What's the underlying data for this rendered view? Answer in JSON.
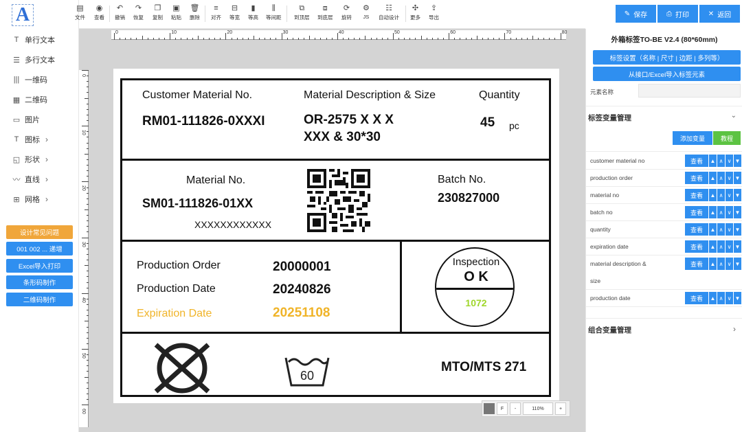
{
  "sidebar": {
    "logo": "A",
    "tools": [
      {
        "icon": "T",
        "label": "单行文本"
      },
      {
        "icon": "☰",
        "label": "多行文本"
      },
      {
        "icon": "|||",
        "label": "一维码"
      },
      {
        "icon": "▦",
        "label": "二维码"
      },
      {
        "icon": "▭",
        "label": "图片"
      },
      {
        "icon": "T",
        "label": "图标",
        "chevron": "›"
      },
      {
        "icon": "◱",
        "label": "形状",
        "chevron": "›"
      },
      {
        "icon": "〰",
        "label": "直线",
        "chevron": "›"
      },
      {
        "icon": "⊞",
        "label": "网格",
        "chevron": "›"
      }
    ],
    "buttons": [
      "设计常见问题",
      "001 002 ... 递增",
      "Excel导入打印",
      "条形码制作",
      "二维码制作"
    ]
  },
  "toolbar": {
    "items": [
      {
        "icon": "▤",
        "label": "文件"
      },
      {
        "icon": "◉",
        "label": "查看"
      },
      {
        "icon": "↶",
        "label": "撤销"
      },
      {
        "icon": "↷",
        "label": "恢复"
      },
      {
        "icon": "❐",
        "label": "复制"
      },
      {
        "icon": "▣",
        "label": "粘贴"
      },
      {
        "icon": "🗑",
        "label": "删除"
      },
      {
        "icon": "≡",
        "label": "对齐"
      },
      {
        "icon": "⊟",
        "label": "等宽"
      },
      {
        "icon": "▮",
        "label": "等高"
      },
      {
        "icon": "⫼",
        "label": "等间距"
      },
      {
        "icon": "⧉",
        "label": "到顶层"
      },
      {
        "icon": "⧈",
        "label": "到底层"
      },
      {
        "icon": "⟳",
        "label": "旋转"
      },
      {
        "icon": "⚙",
        "label": "JS"
      },
      {
        "icon": "☷",
        "label": "自动设计"
      },
      {
        "icon": "✣",
        "label": "更多"
      },
      {
        "icon": "⇪",
        "label": "导出"
      }
    ],
    "save": "保存",
    "print": "打印",
    "back": "返回"
  },
  "ruler": {
    "top": [
      "0",
      "10",
      "20",
      "30",
      "40",
      "50",
      "60",
      "70",
      "80"
    ],
    "left": [
      "0",
      "10",
      "20",
      "30",
      "40",
      "50",
      "60"
    ]
  },
  "label": {
    "customer_material_title": "Customer Material No.",
    "customer_material_value": "RM01-111826-0XXXI",
    "desc_title": "Material Description & Size",
    "desc_line1": "OR-2575 X X X",
    "desc_line2": "XXX &  30*30",
    "qty_title": "Quantity",
    "qty_value": "45",
    "qty_unit": "pc",
    "material_title": "Material No.",
    "material_value": "SM01-111826-01XX",
    "material_sub": "XXXXXXXXXXXX",
    "batch_title": "Batch No.",
    "batch_value": "230827000",
    "prod_order_label": "Production Order",
    "prod_order_value": "20000001",
    "prod_date_label": "Production Date",
    "prod_date_value": "20240826",
    "exp_date_label": "Expiration Date",
    "exp_date_value": "20251108",
    "inspection_title": "Inspection",
    "inspection_ok": "O K",
    "inspection_code": "1072",
    "wash_temp": "60",
    "mto": "MTO/MTS 271"
  },
  "zoom": {
    "f": "F",
    "minus": "-",
    "value": "110%",
    "plus": "+"
  },
  "right": {
    "title": "外箱标签TO-BE V2.4 (80*60mm)",
    "settings_btn": "标签设置（名称 | 尺寸 | 边距 | 多列等）",
    "import_btn": "从接口/Excel导入标签元素",
    "element_name_label": "元素名称",
    "var_section": "标签变量管理",
    "add_var": "添加变量",
    "tutorial": "教程",
    "view": "查看",
    "variables": [
      "customer material no",
      "production order",
      "material no",
      "batch no",
      "quantity",
      "expiration date",
      "material description &",
      "production date"
    ],
    "size_label": "size",
    "combo_section": "组合变量管理"
  },
  "colors": {
    "primary": "#2f8ff0",
    "orange": "#f0a63a",
    "green": "#5cc342",
    "exp_yellow": "#f0b429",
    "lime": "#9fd62a"
  }
}
